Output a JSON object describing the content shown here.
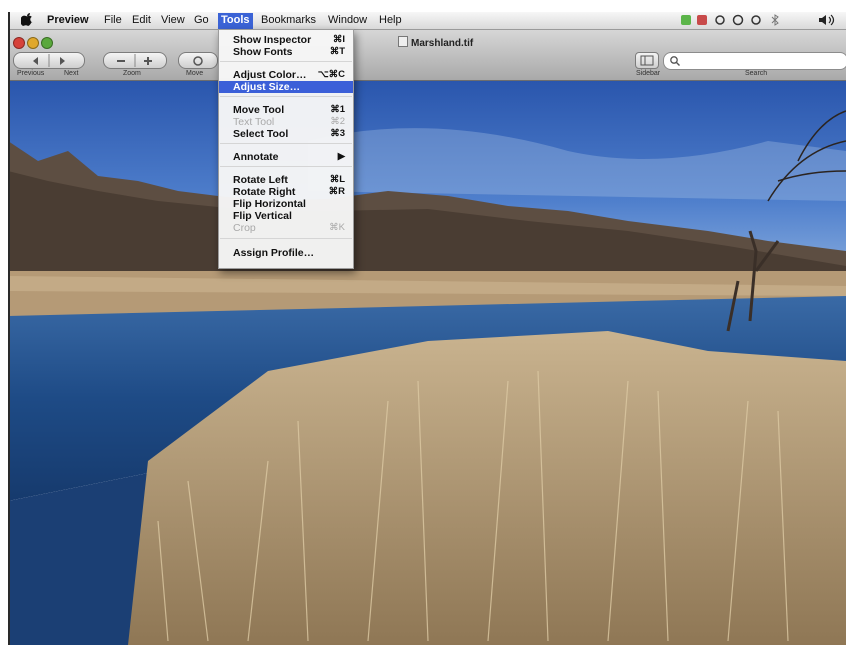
{
  "menubar": {
    "apple": "",
    "items": [
      "Preview",
      "File",
      "Edit",
      "View",
      "Go",
      "Tools",
      "Bookmarks",
      "Window",
      "Help"
    ],
    "active": "Tools"
  },
  "window": {
    "title": "Marshland.tif",
    "toolbar": {
      "previous_label": "Previous",
      "next_label": "Next",
      "zoom_label": "Zoom",
      "move_label": "Move",
      "sidebar_label": "Sidebar",
      "search_label": "Search"
    }
  },
  "tools_menu": {
    "items": [
      {
        "label": "Show Inspector",
        "shortcut": "⌘I",
        "enabled": true
      },
      {
        "label": "Show Fonts",
        "shortcut": "⌘T",
        "enabled": true
      },
      {
        "label": "Adjust Color…",
        "shortcut": "⌥⌘C",
        "enabled": true
      },
      {
        "label": "Adjust Size…",
        "shortcut": "",
        "enabled": true,
        "highlighted": true
      },
      {
        "label": "Move Tool",
        "shortcut": "⌘1",
        "enabled": true
      },
      {
        "label": "Text Tool",
        "shortcut": "⌘2",
        "enabled": false
      },
      {
        "label": "Select Tool",
        "shortcut": "⌘3",
        "enabled": true
      },
      {
        "label": "Annotate",
        "shortcut": "▶",
        "enabled": true
      },
      {
        "label": "Rotate Left",
        "shortcut": "⌘L",
        "enabled": true
      },
      {
        "label": "Rotate Right",
        "shortcut": "⌘R",
        "enabled": true
      },
      {
        "label": "Flip Horizontal",
        "shortcut": "",
        "enabled": true
      },
      {
        "label": "Flip Vertical",
        "shortcut": "",
        "enabled": true
      },
      {
        "label": "Crop",
        "shortcut": "⌘K",
        "enabled": false
      },
      {
        "label": "Assign Profile…",
        "shortcut": "",
        "enabled": true
      }
    ]
  },
  "colors": {
    "menu_highlight": "#3b5fd8",
    "sky": "#2f5fb5",
    "water": "#1f4f8c",
    "reeds": "#b9a17a"
  }
}
